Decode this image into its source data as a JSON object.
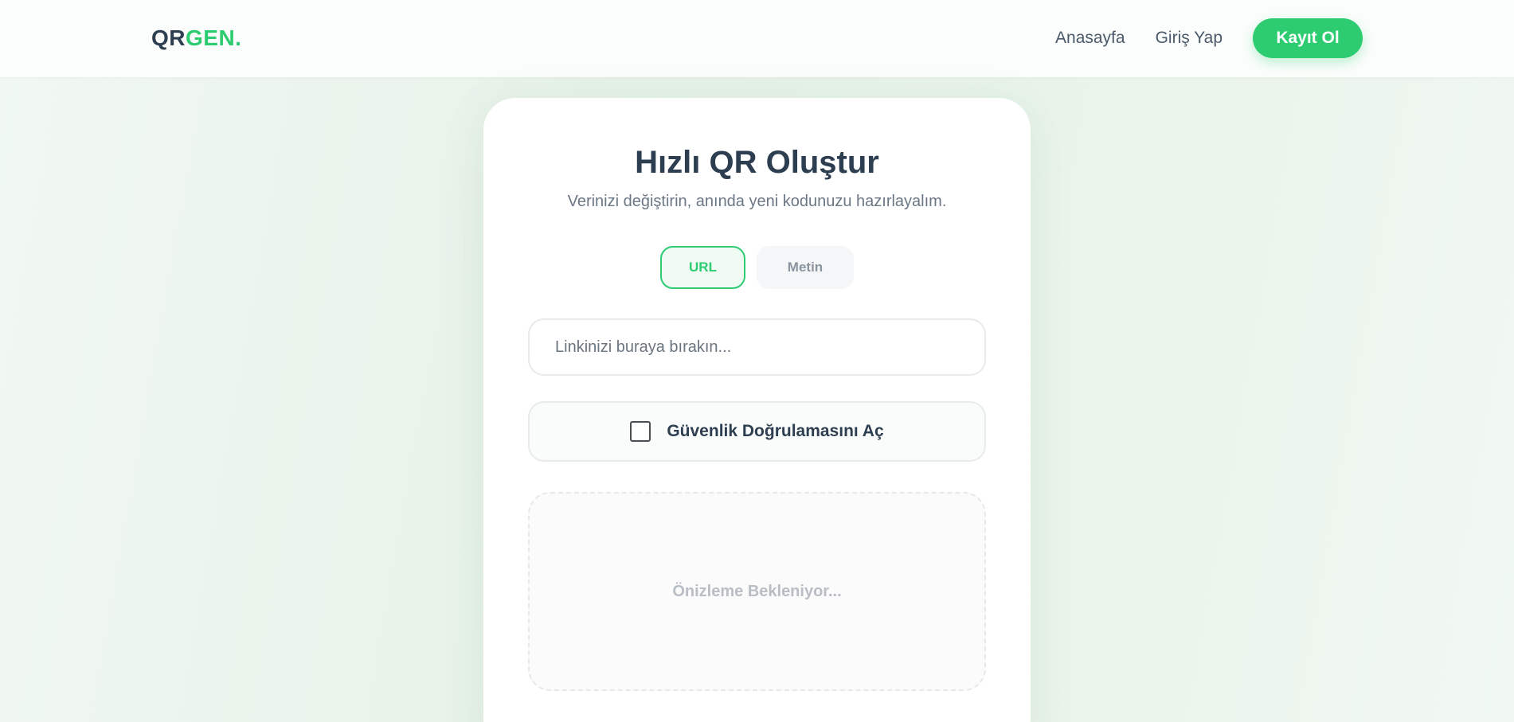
{
  "header": {
    "logo_part1": "QR",
    "logo_part2": "GEN.",
    "nav": {
      "home": "Anasayfa",
      "login": "Giriş Yap",
      "signup": "Kayıt Ol"
    }
  },
  "card": {
    "title": "Hızlı QR Oluştur",
    "subtitle": "Verinizi değiştirin, anında yeni kodunuzu hazırlayalım.",
    "tabs": [
      {
        "label": "URL",
        "active": true
      },
      {
        "label": "Metin",
        "active": false
      }
    ],
    "input": {
      "value": "",
      "placeholder": "Linkinizi buraya bırakın..."
    },
    "security": {
      "label": "Güvenlik Doğrulamasını Aç",
      "checked": false
    },
    "preview": {
      "text": "Önizleme Bekleniyor..."
    }
  },
  "colors": {
    "accent": "#2ecc71",
    "text_dark": "#2c3e50",
    "background": "#e9f4ea"
  },
  "icons": {
    "checkbox": "checkbox-unchecked-icon"
  }
}
